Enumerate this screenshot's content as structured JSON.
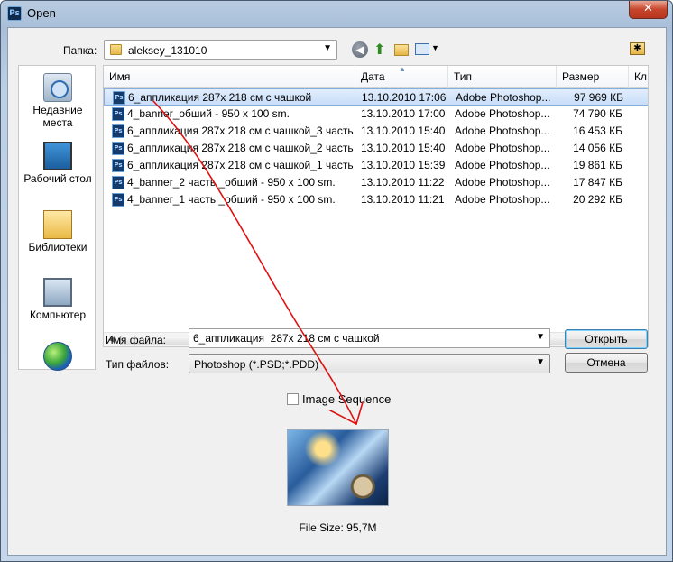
{
  "window": {
    "title": "Open",
    "app_icon": "Ps",
    "close": "✕"
  },
  "toolbar": {
    "look_in_label": "Папка:",
    "folder": "aleksey_131010",
    "back_icon": "back-arrow-icon",
    "up_icon": "up-folder-icon",
    "new_folder_icon": "new-folder-icon",
    "view_icon": "view-menu-icon"
  },
  "places": [
    {
      "label": "Недавние места",
      "icon": "recent-places-icon"
    },
    {
      "label": "Рабочий стол",
      "icon": "desktop-icon"
    },
    {
      "label": "Библиотеки",
      "icon": "libraries-icon"
    },
    {
      "label": "Компьютер",
      "icon": "computer-icon"
    },
    {
      "label": "",
      "icon": "network-icon"
    }
  ],
  "columns": {
    "name": "Имя",
    "date": "Дата",
    "type": "Тип",
    "size": "Размер",
    "extra": "Кл"
  },
  "files": [
    {
      "name": "6_аппликация  287x 218 см с чашкой",
      "date": "13.10.2010 17:06",
      "type": "Adobe Photoshop...",
      "size": "97 969 КБ",
      "selected": true
    },
    {
      "name": "4_banner_обший - 950 x 100 sm.",
      "date": "13.10.2010 17:00",
      "type": "Adobe Photoshop...",
      "size": "74 790 КБ"
    },
    {
      "name": "6_аппликация  287x 218 см с чашкой_3 часть",
      "date": "13.10.2010 15:40",
      "type": "Adobe Photoshop...",
      "size": "16 453 КБ"
    },
    {
      "name": "6_аппликация  287x 218 см с чашкой_2 часть",
      "date": "13.10.2010 15:40",
      "type": "Adobe Photoshop...",
      "size": "14 056 КБ"
    },
    {
      "name": "6_аппликация  287x 218 см с чашкой_1 часть",
      "date": "13.10.2010 15:39",
      "type": "Adobe Photoshop...",
      "size": "19 861 КБ"
    },
    {
      "name": "4_banner_2 часть _обший - 950 x 100 sm.",
      "date": "13.10.2010 11:22",
      "type": "Adobe Photoshop...",
      "size": "17 847 КБ"
    },
    {
      "name": "4_banner_1 часть _обший - 950 x 100 sm.",
      "date": "13.10.2010 11:21",
      "type": "Adobe Photoshop...",
      "size": "20 292 КБ"
    }
  ],
  "form": {
    "filename_label": "Имя файла:",
    "filename_value": "6_аппликация  287x 218 см с чашкой",
    "filetype_label": "Тип файлов:",
    "filetype_value": "Photoshop (*.PSD;*.PDD)",
    "open_button": "Открыть",
    "cancel_button": "Отмена"
  },
  "options": {
    "image_sequence_label": "Image Sequence",
    "image_sequence_checked": false
  },
  "preview": {
    "file_size": "File Size: 95,7M"
  },
  "colors": {
    "selection": "#cce0f8",
    "annotation": "#e01010"
  }
}
